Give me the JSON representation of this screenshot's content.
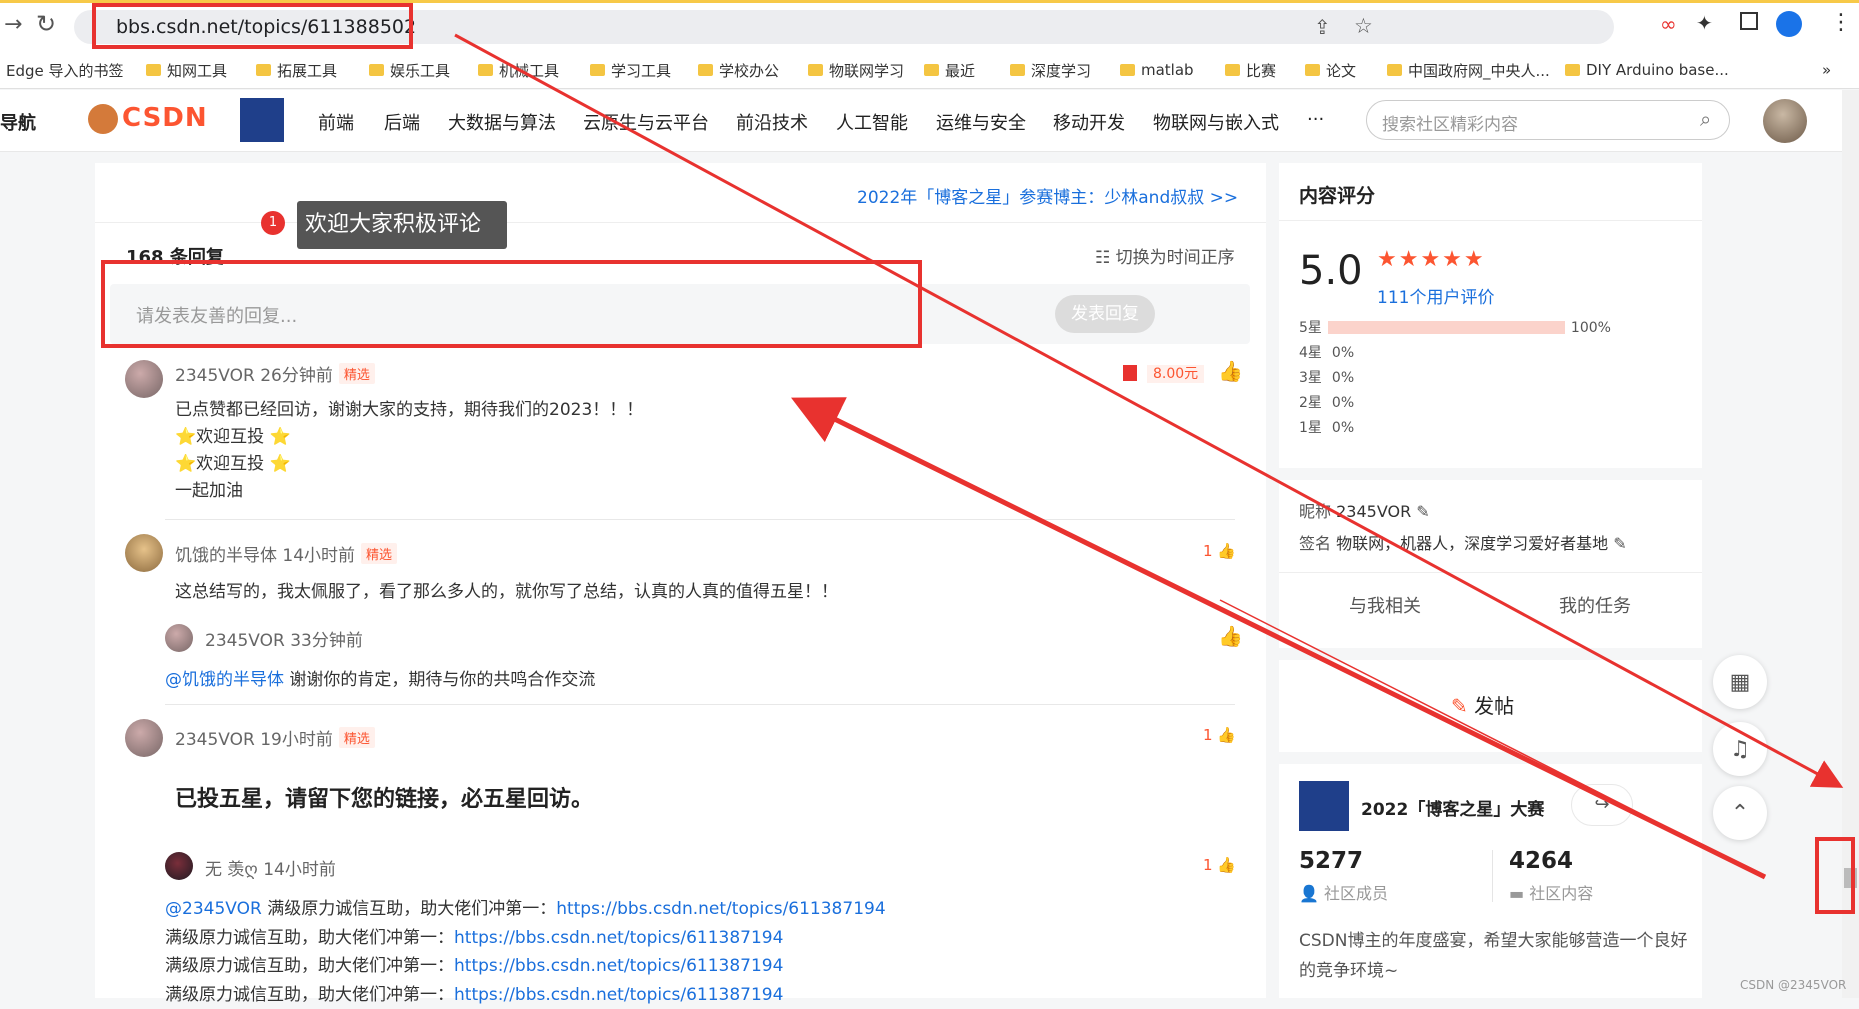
{
  "browser": {
    "url": "bbs.csdn.net/topics/611388502",
    "bookmarks": [
      "Edge 导入的书签",
      "知网工具",
      "拓展工具",
      "娱乐工具",
      "机械工具",
      "学习工具",
      "学校办公",
      "物联网学习",
      "最近",
      "深度学习",
      "matlab",
      "比赛",
      "论文",
      "中国政府网_中央人...",
      "DIY Arduino base..."
    ],
    "more": "»"
  },
  "nav": {
    "guide": "导航",
    "logo": "CSDN",
    "items": [
      "前端",
      "后端",
      "大数据与算法",
      "云原生与云平台",
      "前沿技术",
      "人工智能",
      "运维与安全",
      "移动开发",
      "物联网与嵌入式",
      "···"
    ],
    "search_placeholder": "搜索社区精彩内容"
  },
  "main": {
    "banner": "2022年「博客之星」参赛博主：少林and叔叔  >>",
    "tooltip_num": "1",
    "tooltip": "欢迎大家积极评论",
    "reply_count": "168 条回复",
    "sort": "切换为时间正序",
    "reply_placeholder": "请发表友善的回复...",
    "submit": "发表回复",
    "comments": [
      {
        "user": "2345VOR",
        "time": "26分钟前",
        "badge": "精选",
        "reward": "8.00元",
        "lines": [
          "已点赞都已经回访，谢谢大家的支持，期待我们的2023！！！",
          "⭐欢迎互投 ⭐",
          "⭐欢迎互投 ⭐",
          "一起加油"
        ]
      },
      {
        "user": "饥饿的半导体",
        "time": "14小时前",
        "badge": "精选",
        "likes": "1",
        "lines": [
          "这总结写的，我太佩服了，看了那么多人的，就你写了总结，认真的人真的值得五星！！"
        ]
      },
      {
        "user": "2345VOR",
        "time": "33分钟前",
        "mention": "@饥饿的半导体",
        "text": "谢谢你的肯定，期待与你的共鸣合作交流"
      },
      {
        "user": "2345VOR",
        "time": "19小时前",
        "badge": "精选",
        "likes": "1",
        "lines": [
          "已投五星，请留下您的链接，必五星回访。"
        ]
      },
      {
        "user": "无 羡ღ",
        "time": "14小时前",
        "likes": "1",
        "mention": "@2345VOR",
        "prefix": "满级原力诚信互助，助大佬们冲第一：",
        "link": "https://bbs.csdn.net/topics/611387194"
      }
    ]
  },
  "side": {
    "rating_title": "内容评分",
    "score": "5.0",
    "users": "111个用户评价",
    "rows": [
      {
        "label": "5星",
        "pct": "100%",
        "value": 1.0
      },
      {
        "label": "4星",
        "pct": "0%",
        "value": 0
      },
      {
        "label": "3星",
        "pct": "0%",
        "value": 0
      },
      {
        "label": "2星",
        "pct": "0%",
        "value": 0
      },
      {
        "label": "1星",
        "pct": "0%",
        "value": 0
      }
    ],
    "nick_label": "昵称",
    "nick": "2345VOR",
    "sign_label": "签名",
    "sign": "物联网，机器人，深度学习爱好者基地",
    "tab1": "与我相关",
    "tab2": "我的任务",
    "post": "发帖",
    "event": "2022「博客之星」大赛",
    "members": "5277",
    "members_label": "社区成员",
    "content": "4264",
    "content_label": "社区内容",
    "desc": "CSDN博主的年度盛宴，希望大家能够营造一个良好的竞争环境~"
  },
  "watermark": "CSDN @2345VOR",
  "colors": {
    "accent": "#fc5531",
    "link": "#1a6fdc",
    "annotation": "#e8322f"
  }
}
